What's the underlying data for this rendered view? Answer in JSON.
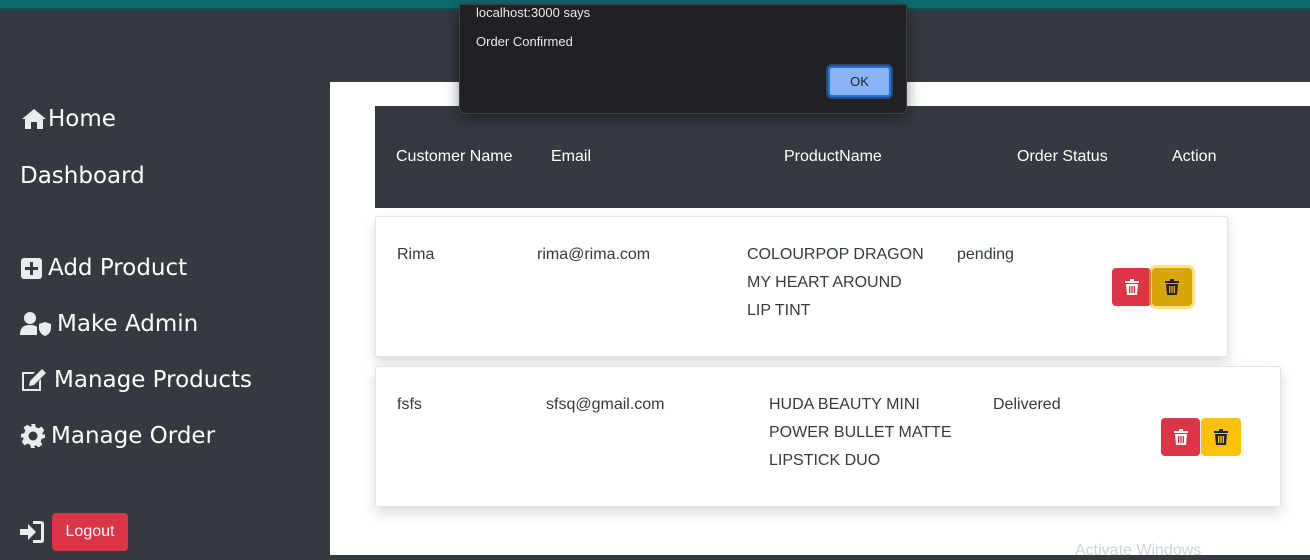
{
  "sidebar": {
    "items": [
      {
        "label": "Home",
        "icon": "home-icon"
      },
      {
        "label": "Dashboard",
        "icon": ""
      },
      {
        "label": "Add Product",
        "icon": "plus-square-icon"
      },
      {
        "label": "Make Admin",
        "icon": "user-shield-icon"
      },
      {
        "label": "Manage Products",
        "icon": "edit-icon"
      },
      {
        "label": "Manage Order",
        "icon": "gear-icon"
      }
    ],
    "logout": {
      "label": "Logout",
      "icon": "sign-in-icon"
    }
  },
  "table": {
    "headers": [
      "Customer Name",
      "Email",
      "ProductName",
      "Order Status",
      "Action"
    ],
    "rows": [
      {
        "customer": "Rima",
        "email": "rima@rima.com",
        "product_lines": [
          "COLOURPOP DRAGON",
          "MY HEART AROUND",
          "LIP TINT"
        ],
        "status": "pending"
      },
      {
        "customer": "fsfs",
        "email": "sfsq@gmail.com",
        "product_lines": [
          "HUDA BEAUTY MINI",
          "POWER BULLET MATTE",
          "LIPSTICK DUO"
        ],
        "status": "Delivered"
      }
    ]
  },
  "dialog": {
    "title": "localhost:3000 says",
    "message": "Order Confirmed",
    "ok_label": "OK"
  },
  "footer": {
    "text": "Activate Windows"
  },
  "colors": {
    "sidebar_bg": "#343a40",
    "topbar": "#0d6b6e",
    "danger": "#dc3545",
    "warning": "#ffc107",
    "dialog_bg": "#202124",
    "dialog_button": "#8ab4f8"
  }
}
